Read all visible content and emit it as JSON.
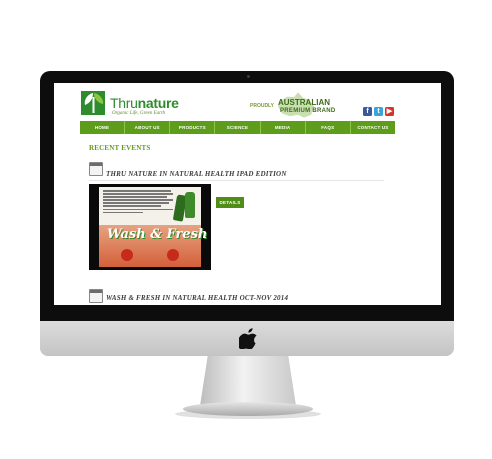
{
  "brand": {
    "name_part1": "Thru",
    "name_part2": "nature",
    "tagline": "Organic Life, Green Earth"
  },
  "badge": {
    "proudly": "PROUDLY",
    "line1": "AUSTRALIAN",
    "line2": "PREMIUM BRAND"
  },
  "social": {
    "facebook": "f",
    "twitter": "t",
    "youtube": "▶"
  },
  "nav": {
    "items": [
      "HOME",
      "ABOUT US",
      "PRODUCTS",
      "SCIENCE",
      "MEDIA",
      "FAQS",
      "CONTACT US"
    ]
  },
  "section_title": "RECENT EVENTS",
  "events": [
    {
      "title": "THRU NATURE IN NATURAL HEALTH IPAD EDITION",
      "thumb_headline": "Wash & Fresh",
      "button": "DETAILS"
    },
    {
      "title": "WASH & FRESH IN NATURAL HEALTH OCT-NOV 2014"
    }
  ],
  "colors": {
    "accent_green": "#5e9d1c",
    "nav_green": "#5e9d1c",
    "heading_green": "#5e9d1c"
  }
}
